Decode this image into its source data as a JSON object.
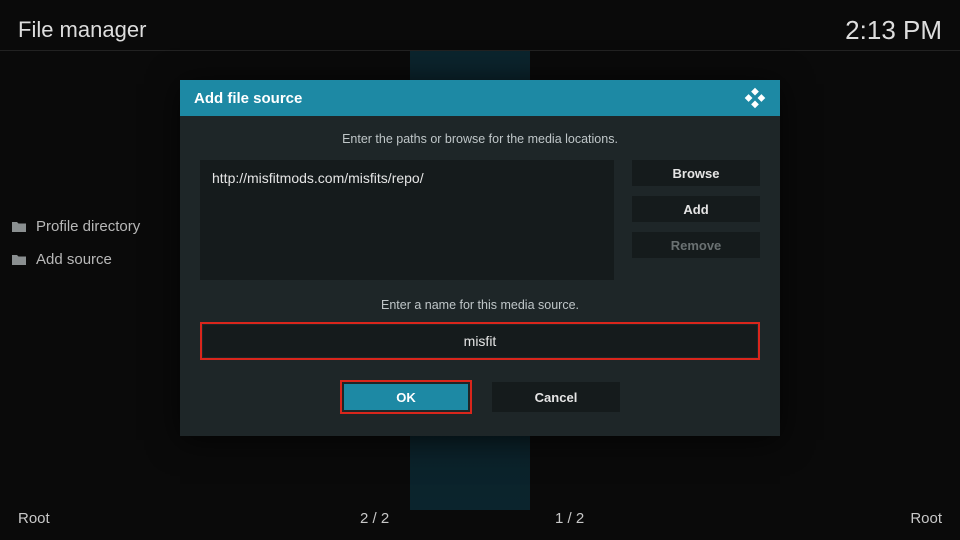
{
  "header": {
    "title": "File manager",
    "time": "2:13 PM"
  },
  "sidebar": {
    "items": [
      {
        "label": "Profile directory"
      },
      {
        "label": "Add source"
      }
    ]
  },
  "footer": {
    "left_label": "Root",
    "right_label": "Root",
    "count_left": "2 / 2",
    "count_right": "1 / 2"
  },
  "dialog": {
    "title": "Add file source",
    "instruction": "Enter the paths or browse for the media locations.",
    "path_value": "http://misfitmods.com/misfits/repo/",
    "browse_label": "Browse",
    "add_label": "Add",
    "remove_label": "Remove",
    "name_instruction": "Enter a name for this media source.",
    "name_value": "misfit",
    "ok_label": "OK",
    "cancel_label": "Cancel"
  }
}
